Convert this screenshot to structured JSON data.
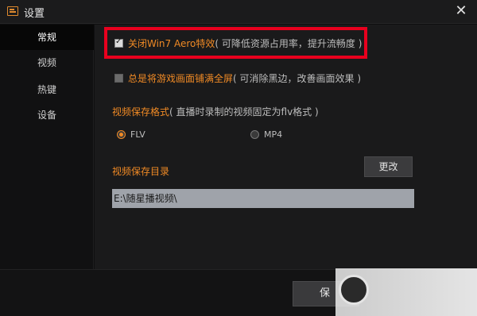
{
  "window": {
    "title": "设置",
    "close_glyph": "✕"
  },
  "sidebar": {
    "items": [
      {
        "label": "常规",
        "active": true
      },
      {
        "label": "视频",
        "active": false
      },
      {
        "label": "热键",
        "active": false
      },
      {
        "label": "设备",
        "active": false
      }
    ]
  },
  "options": {
    "aero": {
      "label": "关闭Win7 Aero特效",
      "note": "( 可降低资源占用率，提升流畅度 )",
      "checked": true
    },
    "fullscreen": {
      "label": "总是将游戏画面铺满全屏",
      "note": "( 可消除黑边，改善画面效果 )",
      "checked": false
    }
  },
  "video_format": {
    "title": "视频保存格式",
    "note": "( 直播时录制的视频固定为flv格式 )",
    "options": [
      {
        "label": "FLV",
        "selected": true
      },
      {
        "label": "MP4",
        "selected": false
      }
    ]
  },
  "save_dir": {
    "title": "视频保存目录",
    "change_label": "更改",
    "path": "E:\\随星播视频\\"
  },
  "footer": {
    "save_label": "保"
  },
  "colors": {
    "accent": "#f08a25",
    "highlight_border": "#e8001e"
  }
}
